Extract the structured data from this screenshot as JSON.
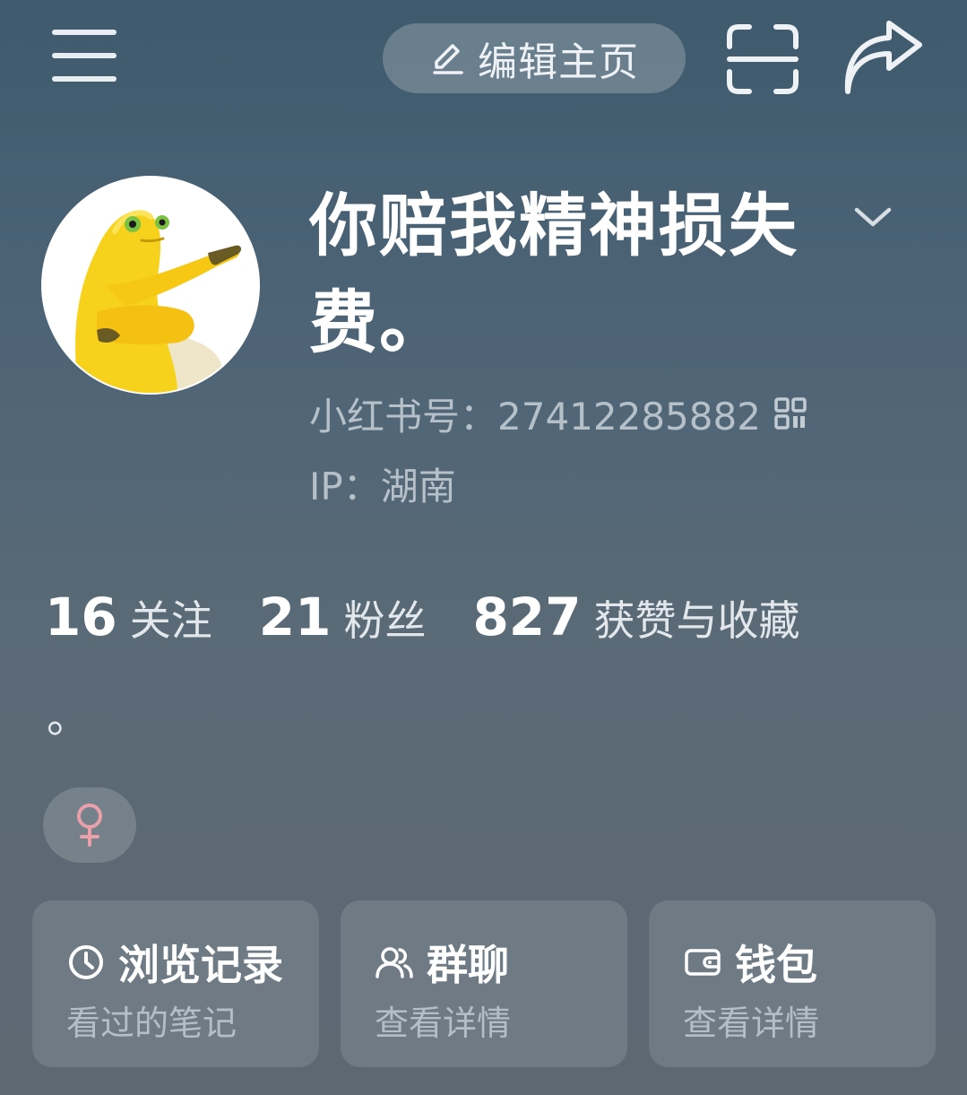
{
  "header": {
    "menu_icon": "menu-icon",
    "edit_label": "编辑主页",
    "edit_icon": "pencil-icon",
    "scan_icon": "scan-icon",
    "share_icon": "share-icon"
  },
  "profile": {
    "avatar_icon": "yellow-creature-avatar",
    "username": "你赔我精神损失费。",
    "red_id": "小红书号：27412285882",
    "ip": "IP：湖南"
  },
  "stats": [
    {
      "value": "16",
      "label": "关注"
    },
    {
      "value": "21",
      "label": "粉丝"
    },
    {
      "value": "827",
      "label": "获赞与收藏"
    }
  ],
  "bio": "。",
  "gender": "♀",
  "cards": [
    {
      "title": "浏览记录",
      "subtitle": "看过的笔记",
      "icon": "clock-icon"
    },
    {
      "title": "群聊",
      "subtitle": "查看详情",
      "icon": "group-icon"
    },
    {
      "title": "钱包",
      "subtitle": "查看详情",
      "icon": "wallet-icon"
    }
  ],
  "colors": {
    "accent_pink": "#e9a0aa",
    "background_top": "#3f5a6d",
    "background_bottom": "#5c6872"
  }
}
